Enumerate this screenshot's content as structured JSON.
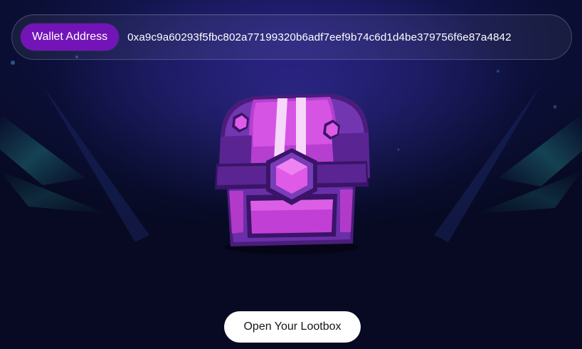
{
  "wallet": {
    "label": "Wallet Address",
    "address": "0xa9c9a60293f5fbc802a77199320b6adf7eef9b74c6d1d4be379756f6e87a4842"
  },
  "chest": {
    "icon": "treasure-chest-icon",
    "colors": {
      "body": "#6a2fa8",
      "dark": "#4a1d7c",
      "panel": "#c23fd6",
      "gem": "#e05ae8"
    }
  },
  "actions": {
    "open_label": "Open Your Lootbox"
  },
  "theme": {
    "background": "#0b0f36",
    "accent": "#7314b8",
    "light_ray": "#2aa6a0"
  }
}
